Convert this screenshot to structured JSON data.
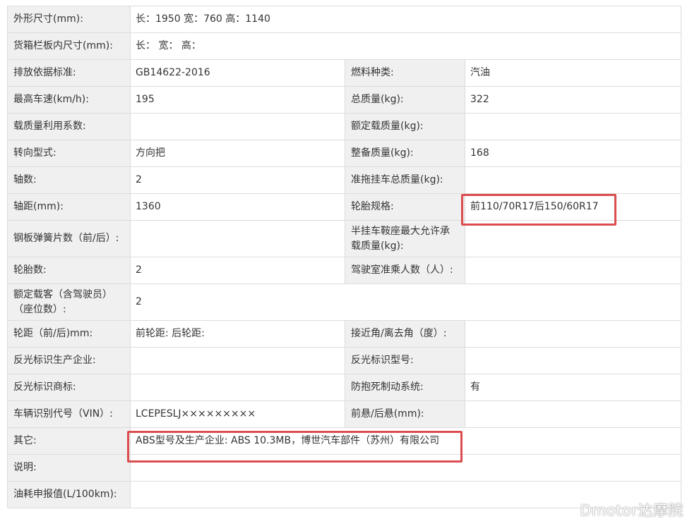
{
  "rows": [
    {
      "l1": "外形尺寸(mm):",
      "v1": "长：1950 宽：760 高：1140"
    },
    {
      "l1": "货箱栏板内尺寸(mm):",
      "v1": "长：  宽：  高："
    },
    {
      "l1": "排放依据标准:",
      "v1": "GB14622-2016",
      "l2": "燃料种类:",
      "v2": "汽油"
    },
    {
      "l1": "最高车速(km/h):",
      "v1": "195",
      "l2": "总质量(kg):",
      "v2": "322"
    },
    {
      "l1": "载质量利用系数:",
      "v1": "",
      "l2": "额定载质量(kg):",
      "v2": ""
    },
    {
      "l1": "转向型式:",
      "v1": "方向把",
      "l2": "整备质量(kg):",
      "v2": "168"
    },
    {
      "l1": "轴数:",
      "v1": "2",
      "l2": "准拖挂车总质量(kg):",
      "v2": ""
    },
    {
      "l1": "轴距(mm):",
      "v1": "1360",
      "l2": "轮胎规格:",
      "v2": "前110/70R17后150/60R17"
    },
    {
      "l1": "钢板弹簧片数（前/后）:",
      "v1": "",
      "l2": "半挂车鞍座最大允许承载质量(kg):",
      "v2": ""
    },
    {
      "l1": "轮胎数:",
      "v1": "2",
      "l2": "驾驶室准乘人数（人）:",
      "v2": ""
    },
    {
      "l1": "额定载客（含驾驶员）（座位数）:",
      "v1": "2"
    },
    {
      "l1": "轮距（前/后)mm:",
      "v1": "前轮距: 后轮距:",
      "l2": "接近角/离去角（度）:",
      "v2": ""
    },
    {
      "l1": "反光标识生产企业:",
      "v1": "",
      "l2": "反光标识型号:",
      "v2": ""
    },
    {
      "l1": "反光标识商标:",
      "v1": "",
      "l2": "防抱死制动系统:",
      "v2": "有"
    },
    {
      "l1": "车辆识别代号（VIN）:",
      "v1": "LCEPESLJ×××××××××",
      "l2": "前悬/后悬(mm):",
      "v2": ""
    },
    {
      "l1": "其它:",
      "v1": "ABS型号及生产企业: ABS 10.3MB，博世汽车部件（苏州）有限公司"
    },
    {
      "l1": "说明:",
      "v1": ""
    },
    {
      "l1": "油耗申报值(L/100km):",
      "v1": ""
    }
  ],
  "watermark": "Dmotor达摩院",
  "highlight_color": "#dc4d4f"
}
